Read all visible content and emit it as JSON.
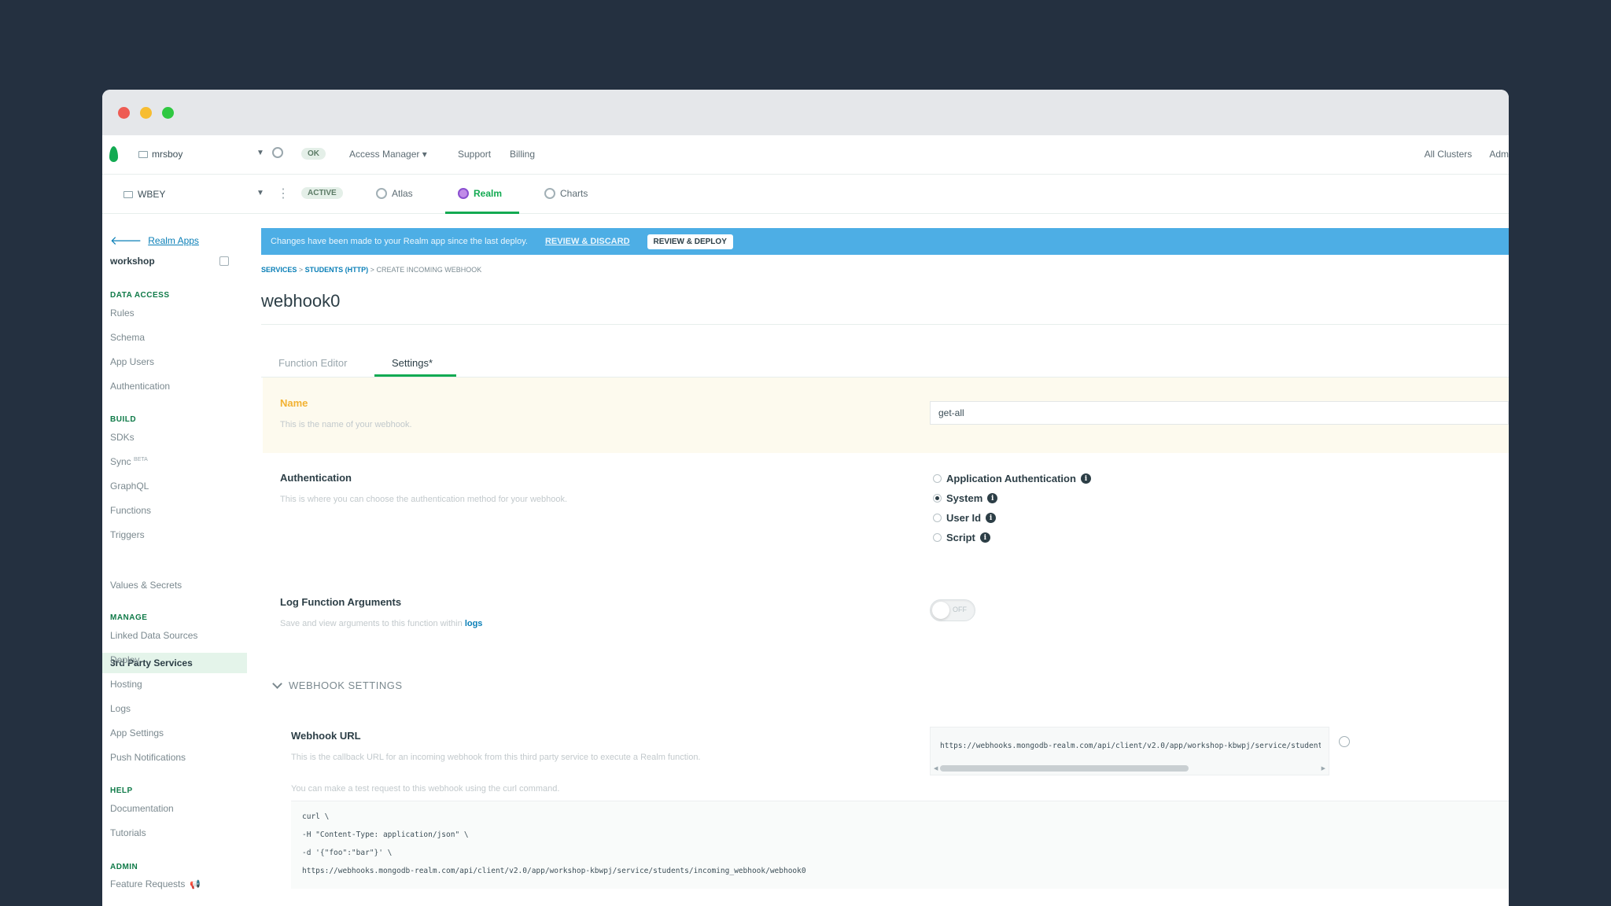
{
  "window": {
    "traffic_lights": [
      "close",
      "minimize",
      "maximize"
    ]
  },
  "topbar": {
    "org_name": "mrsboy",
    "org_badge": "OK",
    "access_manager": "Access Manager",
    "support": "Support",
    "billing": "Billing",
    "all_clusters": "All Clusters",
    "admin": "Adm"
  },
  "projbar": {
    "project_name": "WBEY",
    "status_badge": "ACTIVE",
    "tabs": [
      {
        "label": "Atlas",
        "icon": "atlas-icon"
      },
      {
        "label": "Realm",
        "icon": "realm-icon"
      },
      {
        "label": "Charts",
        "icon": "charts-icon"
      }
    ],
    "active_tab": "Realm"
  },
  "sidebar": {
    "back_link": "Realm Apps",
    "app_name": "workshop",
    "sections": {
      "data_access": "DATA ACCESS",
      "build": "BUILD",
      "manage": "MANAGE",
      "help": "HELP",
      "admin": "ADMIN"
    },
    "data_access_items": [
      "Rules",
      "Schema",
      "App Users",
      "Authentication"
    ],
    "build_items": [
      "SDKs",
      "Sync",
      "GraphQL",
      "Functions",
      "Triggers",
      "3rd Party Services",
      "Values & Secrets"
    ],
    "sync_badge": "BETA",
    "manage_items": [
      "Linked Data Sources",
      "Deploy",
      "Hosting",
      "Logs",
      "App Settings",
      "Push Notifications"
    ],
    "help_items": [
      "Documentation",
      "Tutorials"
    ],
    "admin_items": [
      "Feature Requests"
    ],
    "selected": "3rd Party Services"
  },
  "banner": {
    "message": "Changes have been made to your Realm app since the last deploy.",
    "review_discard": "REVIEW & DISCARD",
    "review_deploy": "REVIEW & DEPLOY"
  },
  "breadcrumb": {
    "services": "SERVICES",
    "students_http": "STUDENTS (HTTP)",
    "current": "CREATE INCOMING WEBHOOK",
    "sep": ">"
  },
  "page": {
    "title": "webhook0"
  },
  "tabs": {
    "function_editor": "Function Editor",
    "settings": "Settings*"
  },
  "settings": {
    "name_label": "Name",
    "name_desc": "This is the name of your webhook.",
    "name_value": "get-all",
    "auth_label": "Authentication",
    "auth_desc": "This is where you can choose the authentication method for your webhook.",
    "auth_options": [
      "Application Authentication",
      "System",
      "User Id",
      "Script"
    ],
    "auth_selected": "System",
    "log_label": "Log Function Arguments",
    "log_desc": "Save and view arguments to this function within",
    "log_link": "logs",
    "log_toggle": "OFF"
  },
  "webhook_settings": {
    "header": "WEBHOOK SETTINGS",
    "url_label": "Webhook URL",
    "url_desc": "This is the callback URL for an incoming webhook from this third party service to execute a Realm function.",
    "url_value": "https://webhooks.mongodb-realm.com/api/client/v2.0/app/workshop-kbwpj/service/students/incoming_webhook/webhook0",
    "curl_desc": "You can make a test request to this webhook using the curl command.",
    "curl_lines": [
      "curl \\",
      "-H \"Content-Type: application/json\" \\",
      "-d '{\"foo\":\"bar\"}' \\",
      "https://webhooks.mongodb-realm.com/api/client/v2.0/app/workshop-kbwpj/service/students/incoming_webhook/webhook0"
    ]
  }
}
